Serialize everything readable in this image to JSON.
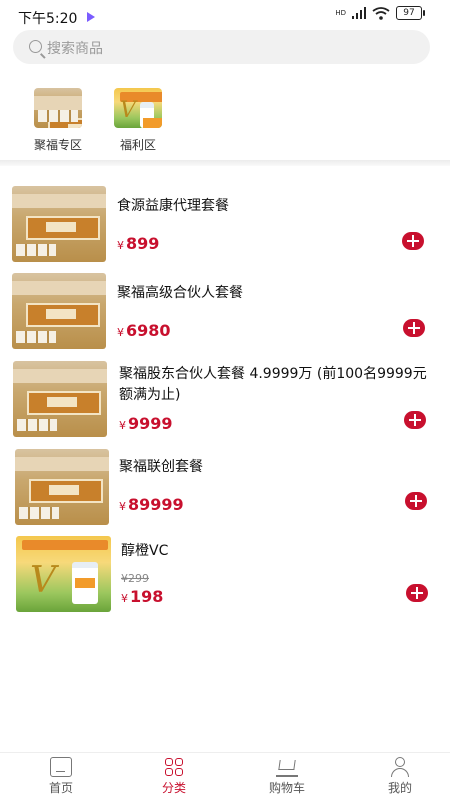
{
  "status_bar": {
    "time": "下午5:20",
    "battery": "97",
    "network": "HD"
  },
  "search": {
    "placeholder": "搜索商品"
  },
  "categories": [
    {
      "label": "聚福专区"
    },
    {
      "label": "福利区"
    }
  ],
  "products": [
    {
      "name": "食源益康代理套餐",
      "currency": "¥",
      "price": "899"
    },
    {
      "name": "聚福高级合伙人套餐",
      "currency": "¥",
      "price": "6980"
    },
    {
      "name": "聚福股东合伙人套餐 4.9999万 (前100名9999元额满为止)",
      "currency": "¥",
      "price": "9999"
    },
    {
      "name": "聚福联创套餐",
      "currency": "¥",
      "price": "89999"
    },
    {
      "name": "醇橙VC",
      "currency": "¥",
      "old_price": "¥299",
      "price": "198"
    }
  ],
  "tabbar": [
    {
      "label": "首页",
      "icon": "home-icon"
    },
    {
      "label": "分类",
      "icon": "grid-icon",
      "active": true
    },
    {
      "label": "购物车",
      "icon": "cart-icon"
    },
    {
      "label": "我的",
      "icon": "user-icon"
    }
  ],
  "colors": {
    "accent": "#c8102e",
    "search_bg": "#f1f1f1"
  }
}
